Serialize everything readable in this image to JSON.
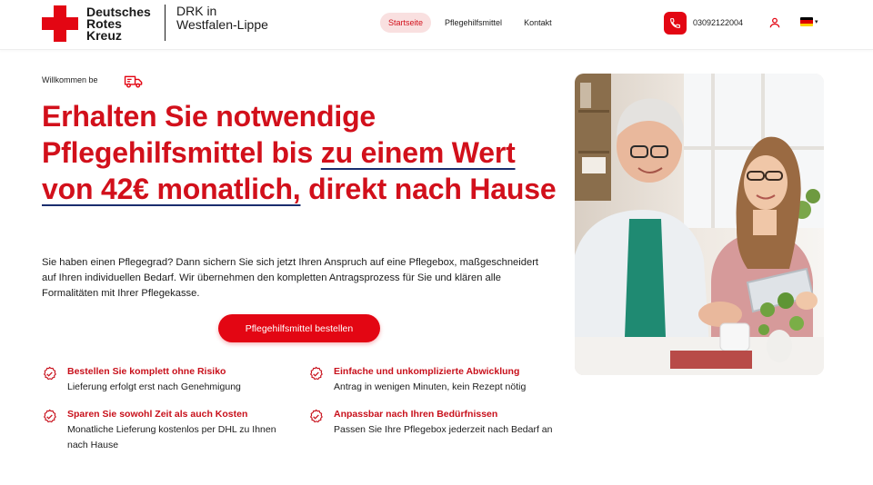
{
  "brand": {
    "logo_line1": "Deutsches",
    "logo_line2": "Rotes",
    "logo_line3": "Kreuz",
    "sub_line1": "DRK in",
    "sub_line2": "Westfalen-Lippe",
    "red": "#e30613"
  },
  "nav": {
    "items": [
      {
        "label": "Startseite",
        "active": true
      },
      {
        "label": "Pflegehilfsmittel",
        "active": false
      },
      {
        "label": "Kontakt",
        "active": false
      }
    ]
  },
  "contact": {
    "phone": "03092122004",
    "phone_icon": "phone-icon",
    "user_icon": "user-icon",
    "language_flag": "flag-de-icon"
  },
  "hero": {
    "welcome": "Willkommen be",
    "headline_part1": "Erhalten Sie notwendige Pflegehilfsmittel bis ",
    "headline_underlined": "zu einem Wert von 42€ monatlich,",
    "headline_part2": " direkt nach Hause",
    "intro": "Sie haben einen Pflegegrad? Dann sichern Sie sich jetzt Ihren Anspruch auf eine Pflegebox, maßgeschneidert auf Ihren individuellen Bedarf. Wir übernehmen den kompletten Antragsprozess für Sie und klären alle Formalitäten mit Ihrer Pflegekasse.",
    "cta_label": "Pflegehilfsmittel bestellen"
  },
  "features": [
    {
      "title": "Bestellen Sie komplett ohne Risiko",
      "desc": "Lieferung erfolgt erst nach Genehmigung"
    },
    {
      "title": "Einfache und unkomplizierte Abwicklung",
      "desc": "Antrag in wenigen Minuten, kein Rezept nötig"
    },
    {
      "title": "Sparen Sie sowohl Zeit als auch Kosten",
      "desc": "Monatliche Lieferung kostenlos per DHL zu Ihnen nach Hause"
    },
    {
      "title": "Anpassbar nach Ihren Bedürfnissen",
      "desc": "Passen Sie Ihre Pflegebox jederzeit nach Bedarf an"
    }
  ]
}
